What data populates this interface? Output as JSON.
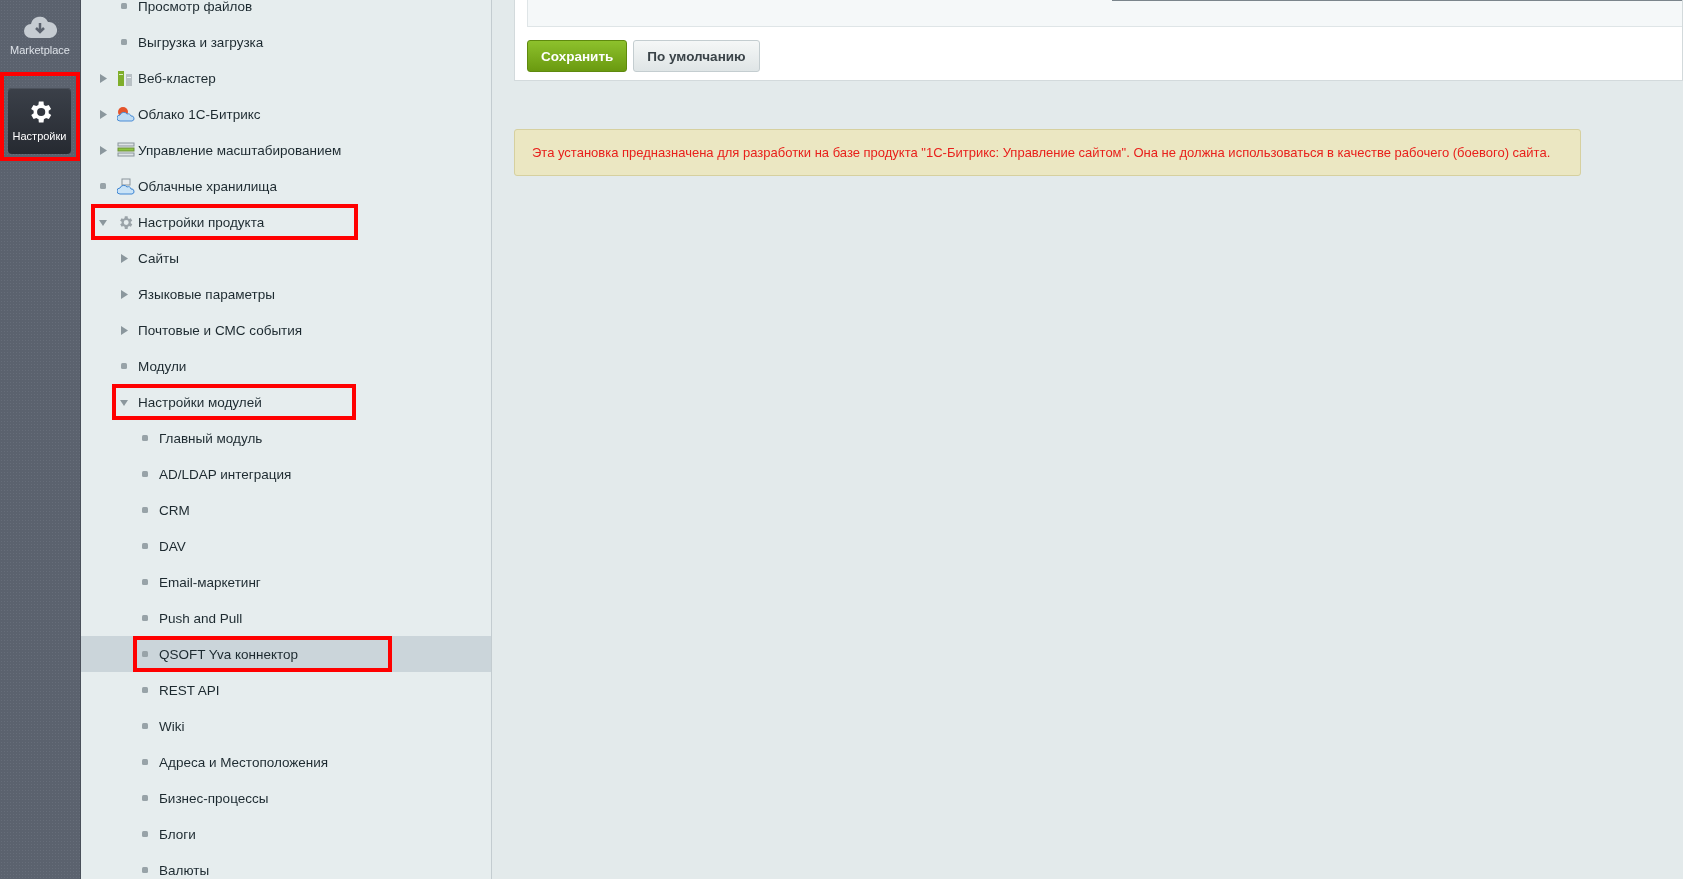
{
  "panel": {
    "items": [
      {
        "label": "Marketplace",
        "selected": false,
        "annotated": false
      },
      {
        "label": "Настройки",
        "selected": true,
        "annotated": true
      }
    ]
  },
  "sidebar": {
    "continued_items": [
      {
        "label": "Просмотр файлов",
        "selected": false,
        "annotated": false
      },
      {
        "label": "Выгрузка и загрузка",
        "selected": false,
        "annotated": false
      }
    ],
    "items": [
      {
        "label": "Веб-кластер",
        "kind": "folder",
        "expanded": false,
        "selected": false,
        "annotated": false
      },
      {
        "label": "Облако 1С-Битрикс",
        "kind": "folder",
        "expanded": false,
        "selected": false,
        "annotated": false
      },
      {
        "label": "Управление масштабированием",
        "kind": "folder",
        "expanded": false,
        "selected": false,
        "annotated": false
      },
      {
        "label": "Облачные хранилища",
        "kind": "leaf",
        "selected": false,
        "annotated": false
      },
      {
        "label": "Настройки продукта",
        "kind": "folder",
        "expanded": true,
        "selected": false,
        "annotated": true,
        "children": [
          {
            "label": "Сайты",
            "kind": "folder",
            "expanded": false,
            "selected": false,
            "annotated": false
          },
          {
            "label": "Языковые параметры",
            "kind": "folder",
            "expanded": false,
            "selected": false,
            "annotated": false
          },
          {
            "label": "Почтовые и СМС события",
            "kind": "folder",
            "expanded": false,
            "selected": false,
            "annotated": false
          },
          {
            "label": "Модули",
            "kind": "leaf",
            "selected": false,
            "annotated": false
          },
          {
            "label": "Настройки модулей",
            "kind": "folder",
            "expanded": true,
            "selected": false,
            "annotated": true,
            "children": [
              {
                "label": "Главный модуль",
                "kind": "leaf",
                "selected": false,
                "annotated": false
              },
              {
                "label": "AD/LDAP интеграция",
                "kind": "leaf",
                "selected": false,
                "annotated": false
              },
              {
                "label": "CRM",
                "kind": "leaf",
                "selected": false,
                "annotated": false
              },
              {
                "label": "DAV",
                "kind": "leaf",
                "selected": false,
                "annotated": false
              },
              {
                "label": "Email-маркетинг",
                "kind": "leaf",
                "selected": false,
                "annotated": false
              },
              {
                "label": "Push and Pull",
                "kind": "leaf",
                "selected": false,
                "annotated": false
              },
              {
                "label": "QSOFT Yva коннектор",
                "kind": "leaf",
                "selected": true,
                "annotated": true
              },
              {
                "label": "REST API",
                "kind": "leaf",
                "selected": false,
                "annotated": false
              },
              {
                "label": "Wiki",
                "kind": "leaf",
                "selected": false,
                "annotated": false
              },
              {
                "label": "Адреса и Местоположения",
                "kind": "leaf",
                "selected": false,
                "annotated": false
              },
              {
                "label": "Бизнес-процессы",
                "kind": "leaf",
                "selected": false,
                "annotated": false
              },
              {
                "label": "Блоги",
                "kind": "leaf",
                "selected": false,
                "annotated": false
              },
              {
                "label": "Валюты",
                "kind": "leaf",
                "selected": false,
                "annotated": false
              }
            ]
          }
        ]
      }
    ]
  },
  "form": {
    "buttons": [
      {
        "label": "Сохранить",
        "kind": "primary"
      },
      {
        "label": "По умолчанию",
        "kind": "default"
      }
    ]
  },
  "notice": {
    "text": "Эта установка предназначена для разработки на базе продукта \"1С-Битрикс: Управление сайтом\". Она не должна использоваться в качестве рабочего (боевого) сайта."
  }
}
